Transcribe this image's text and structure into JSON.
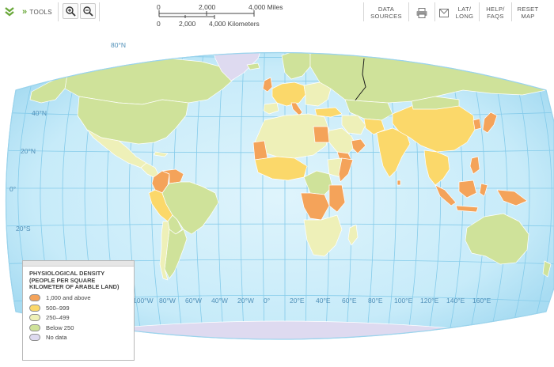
{
  "toolbar": {
    "tools_label": "TOOLS",
    "data_sources": [
      "DATA",
      "SOURCES"
    ],
    "lat_long": [
      "LAT/",
      "LONG"
    ],
    "help_faqs": [
      "HELP/",
      "FAQS"
    ],
    "reset_map": [
      "RESET",
      "MAP"
    ]
  },
  "scale_bar": {
    "miles": [
      "0",
      "2,000",
      "4,000 Miles"
    ],
    "kilometers": [
      "0",
      "2,000",
      "4,000 Kilometers"
    ]
  },
  "map": {
    "latitude_labels": [
      "80°N",
      "40°N",
      "20°N",
      "0°",
      "20°S"
    ],
    "longitude_labels": [
      "100°W",
      "80°W",
      "60°W",
      "40°W",
      "20°W",
      "0°",
      "20°E",
      "40°E",
      "60°E",
      "80°E",
      "100°E",
      "120°E",
      "140°E",
      "160°E"
    ]
  },
  "legend": {
    "title": "PHYSIOLOGICAL DENSITY (PEOPLE PER SQUARE KILOMETER OF ARABLE LAND)",
    "items": [
      {
        "label": "1,000 and above",
        "color": "#f4a35a"
      },
      {
        "label": "500–999",
        "color": "#fbd86a"
      },
      {
        "label": "250–499",
        "color": "#eef0b8"
      },
      {
        "label": "Below 250",
        "color": "#cfe29a"
      },
      {
        "label": "No data",
        "color": "#dedaf0"
      }
    ]
  },
  "colors": {
    "ocean": "#bfe6f6",
    "ocean_inner": "#d9f2fb",
    "graticule": "#7cc4e6",
    "country_border": "#ffffff"
  }
}
